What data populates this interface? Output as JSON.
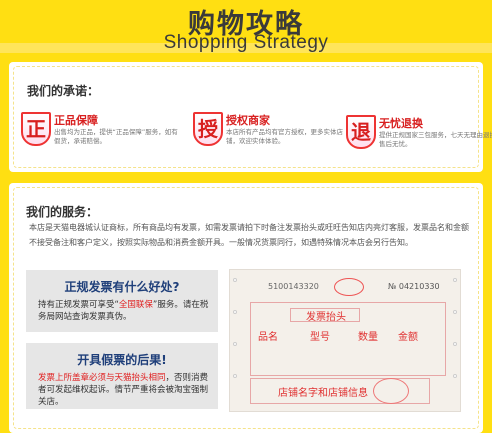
{
  "header": {
    "title": "购物攻略",
    "subtitle": "Shopping Strategy"
  },
  "promise": {
    "heading": "我们的承诺：",
    "items": [
      {
        "icon": "正",
        "title": "正品保障",
        "desc": "出售均为正品，提供“正品保障”服务，如有假货，承诺赔偿。"
      },
      {
        "icon": "授",
        "title": "授权商家",
        "desc": "本店所有产品均有官方授权，更多实体店铺，欢迎实体体验。"
      },
      {
        "icon": "退",
        "title": "无忧退换",
        "desc": "提供正规国家三包服务，七天无理由退换，售后无忧。"
      }
    ]
  },
  "service": {
    "heading": "我们的服务：",
    "text": "本店是天猫电器城认证商标，所有商品均有发票，如需发票请拍下时备注发票抬头或旺旺告知店内亮灯客服，发票品名和金额不接受备注和客户定义，按照实际物品和消费金额开具。一般情况货票同行，如遇特殊情况本店会另行告知。",
    "box1": {
      "title": "正规发票有什么好处?",
      "pre": "持有正规发票可享受“",
      "highlight": "全国联保",
      "post": "”服务。请在税务局网站查询发票真伪。"
    },
    "box2": {
      "title": "开具假票的后果!",
      "highlight": "发票上所盖章必须与天猫抬头相同",
      "post": "，否则消费者可发起维权起诉。情节严重将会被淘宝强制关店。"
    },
    "invoice": {
      "code": "5100143320",
      "number": "№ 04210330",
      "buyer_label": "发票抬头",
      "cols": [
        "品名",
        "型号",
        "数量",
        "金额"
      ],
      "seller_label": "店铺名字和店铺信息"
    }
  }
}
